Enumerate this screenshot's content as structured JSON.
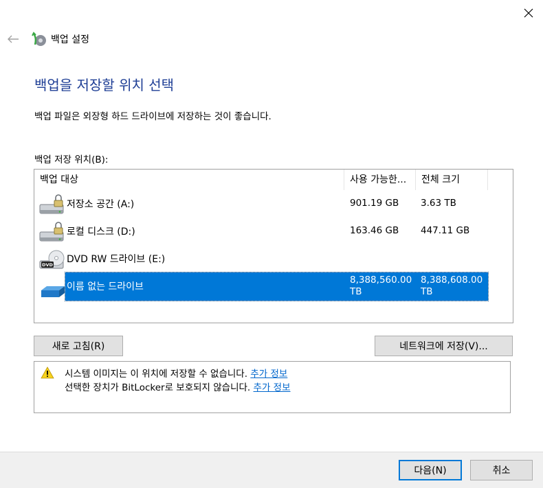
{
  "window": {
    "title": "백업 설정"
  },
  "page": {
    "heading": "백업을 저장할 위치 선택",
    "description": "백업 파일은 외장형 하드 드라이브에 저장하는 것이 좋습니다.",
    "location_label": "백업 저장 위치(B):"
  },
  "list": {
    "columns": [
      "백업 대상",
      "사용 가능한...",
      "전체 크기"
    ],
    "rows": [
      {
        "name": "저장소 공간 (A:)",
        "available": "901.19 GB",
        "total": "3.63 TB",
        "icon": "locked-drive-icon"
      },
      {
        "name": "로컬 디스크 (D:)",
        "available": "163.46 GB",
        "total": "447.11 GB",
        "icon": "locked-drive-icon"
      },
      {
        "name": "DVD RW 드라이브 (E:)",
        "available": "",
        "total": "",
        "icon": "dvd-drive-icon"
      },
      {
        "name": "이름 없는 드라이브",
        "available_line1": "8,388,560.00",
        "available_line2": "TB",
        "total_line1": "8,388,608.00",
        "total_line2": "TB",
        "icon": "usb-drive-icon",
        "selected": true
      }
    ]
  },
  "buttons": {
    "refresh": "새로 고침(R)",
    "network": "네트워크에 저장(V)...",
    "next": "다음(N)",
    "cancel": "취소"
  },
  "warnings": {
    "line1": "시스템 이미지는 이 위치에 저장할 수 없습니다.",
    "line2": "선택한 장치가 BitLocker로 보호되지 않습니다.",
    "more_info": "추가 정보"
  },
  "colors": {
    "heading": "#1e3e95",
    "selection": "#0078d7",
    "link": "#0066cc",
    "footer": "#f0f0f0"
  }
}
